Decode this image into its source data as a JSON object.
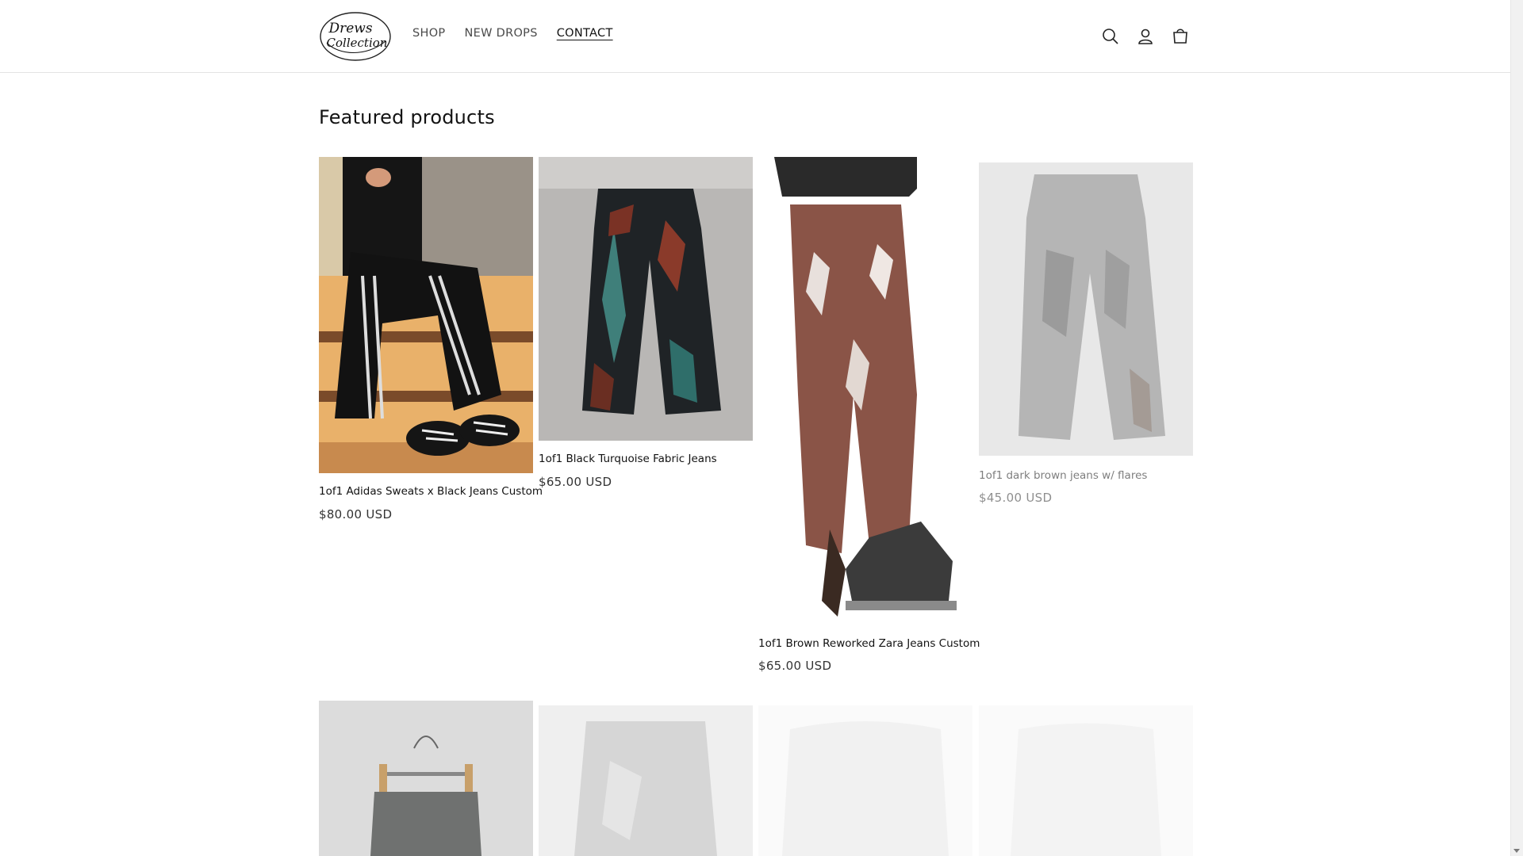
{
  "store": {
    "logo_text_line1": "Drews",
    "logo_text_line2": "Collection"
  },
  "nav": [
    {
      "label": "SHOP"
    },
    {
      "label": "NEW DROPS"
    },
    {
      "label": "CONTACT",
      "active": true
    }
  ],
  "header_icons": [
    "search-icon",
    "account-icon",
    "cart-icon"
  ],
  "section": {
    "title": "Featured products"
  },
  "products": [
    {
      "title": "1of1 Adidas Sweats x Black Jeans Custom",
      "price": "$80.00 USD"
    },
    {
      "title": "1of1 Black Turquoise Fabric Jeans",
      "price": "$65.00 USD"
    },
    {
      "title": "1of1 Brown Reworked Zara Jeans Custom",
      "price": "$65.00 USD"
    },
    {
      "title": "1of1 dark brown jeans w/ flares",
      "price": "$45.00 USD"
    }
  ],
  "colors": {
    "text": "#121212",
    "border": "#e3e3e3",
    "background": "#ffffff"
  }
}
